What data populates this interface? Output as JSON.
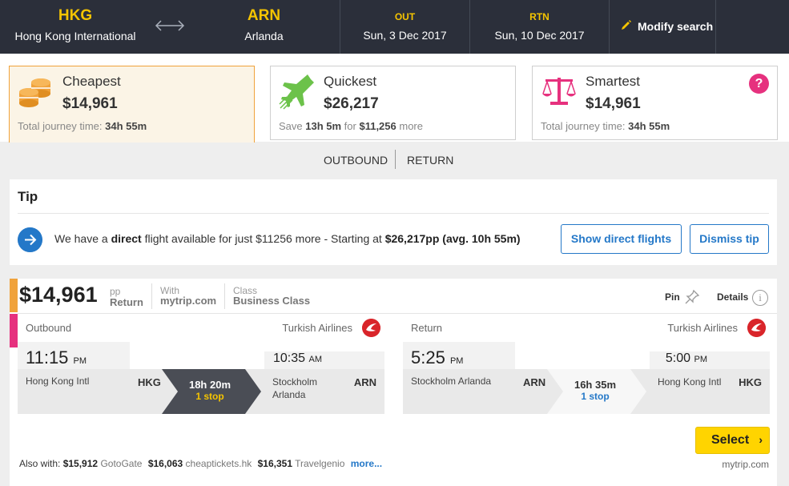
{
  "search": {
    "origin_code": "HKG",
    "origin_name": "Hong Kong International",
    "destination_code": "ARN",
    "destination_name": "Arlanda",
    "out_label": "OUT",
    "out_date": "Sun, 3 Dec 2017",
    "rtn_label": "RTN",
    "rtn_date": "Sun, 10 Dec 2017",
    "modify_label": "Modify search"
  },
  "sort_cards": [
    {
      "title": "Cheapest",
      "price": "$14,961",
      "sub_prefix": "Total journey time: ",
      "sub_bold": "34h 55m",
      "icon": "coins-icon",
      "color": "#f0a23b"
    },
    {
      "title": "Quickest",
      "price": "$26,217",
      "sub_prefix": "Save ",
      "sub_bold": "13h 5m",
      "sub_mid": " for ",
      "sub_bold2": "$11,256",
      "sub_suffix": " more",
      "icon": "plane-speed-icon",
      "color": "#6cc24a"
    },
    {
      "title": "Smartest",
      "price": "$14,961",
      "sub_prefix": "Total journey time: ",
      "sub_bold": "34h 55m",
      "icon": "scales-icon",
      "color": "#e6317e",
      "help": "?"
    }
  ],
  "tabs": [
    "OUTBOUND",
    "RETURN"
  ],
  "tip": {
    "title": "Tip",
    "text_1": "We have a ",
    "text_bold_1": "direct",
    "text_2": " flight available for just $11256 more - Starting at ",
    "text_bold_2": "$26,217pp (avg. 10h 55m)",
    "show_btn": "Show direct flights",
    "dismiss_btn": "Dismiss tip"
  },
  "result": {
    "price": "$14,961",
    "pp": "pp",
    "trip_type": "Return",
    "with_label": "With",
    "with_value": "mytrip.com",
    "class_label": "Class",
    "class_value": "Business Class",
    "pin_label": "Pin",
    "details_label": "Details",
    "info_glyph": "i",
    "outbound": {
      "label": "Outbound",
      "airline": "Turkish Airlines",
      "dep_time": "11:15",
      "dep_ampm": "PM",
      "from_city": "Hong Kong Intl",
      "from_code": "HKG",
      "duration": "18h 20m",
      "stops": "1 stop",
      "arr_time": "10:35",
      "arr_ampm": "AM",
      "to_city_1": "Stockholm",
      "to_city_2": "Arlanda",
      "to_code": "ARN"
    },
    "return": {
      "label": "Return",
      "airline": "Turkish Airlines",
      "dep_time": "5:25",
      "dep_ampm": "PM",
      "from_city": "Stockholm Arlanda",
      "from_code": "ARN",
      "duration": "16h 35m",
      "stops": "1 stop",
      "arr_time": "5:00",
      "arr_ampm": "PM",
      "to_city_1": "Hong Kong Intl",
      "to_city_2": "",
      "to_code": "HKG"
    },
    "select_label": "Select",
    "select_chevron": "›",
    "also_label": "Also with:",
    "also": [
      {
        "price": "$15,912",
        "site": "GotoGate"
      },
      {
        "price": "$16,063",
        "site": "cheaptickets.hk"
      },
      {
        "price": "$16,351",
        "site": "Travelgenio"
      }
    ],
    "more_label": "more...",
    "provider": "mytrip.com"
  },
  "colors": {
    "brand_yellow": "#f5c400",
    "topbar_bg": "#2b2f3a",
    "link_blue": "#2478c8",
    "cheapest_orange": "#f0a23b",
    "smartest_pink": "#e6317e",
    "quickest_green": "#6cc24a",
    "airline_red": "#d9252a"
  }
}
